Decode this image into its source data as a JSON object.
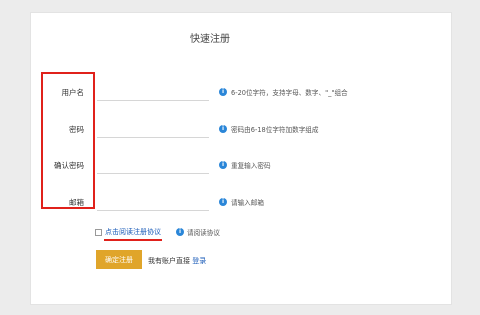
{
  "form": {
    "title": "快速注册",
    "fields": [
      {
        "label": "用户名",
        "hint": "6-20位字符，支持字母、数字、\"_\"组合"
      },
      {
        "label": "密码",
        "hint": "密码由6-18位字符加数字组成"
      },
      {
        "label": "确认密码",
        "hint": "重复输入密码"
      },
      {
        "label": "邮箱",
        "hint": "请输入邮箱"
      }
    ],
    "agreement": {
      "link": "点击阅读注册协议",
      "hint": "请阅读协议"
    },
    "submit_label": "确定注册",
    "login_prompt": "我有账户直接",
    "login_link": "登录"
  },
  "annotation_colors": {
    "red": "#e0211b",
    "button": "#e0a52a",
    "link": "#1a5bb8",
    "info": "#2a86d8"
  },
  "icons": [
    "info-icon",
    "checkbox-icon"
  ]
}
